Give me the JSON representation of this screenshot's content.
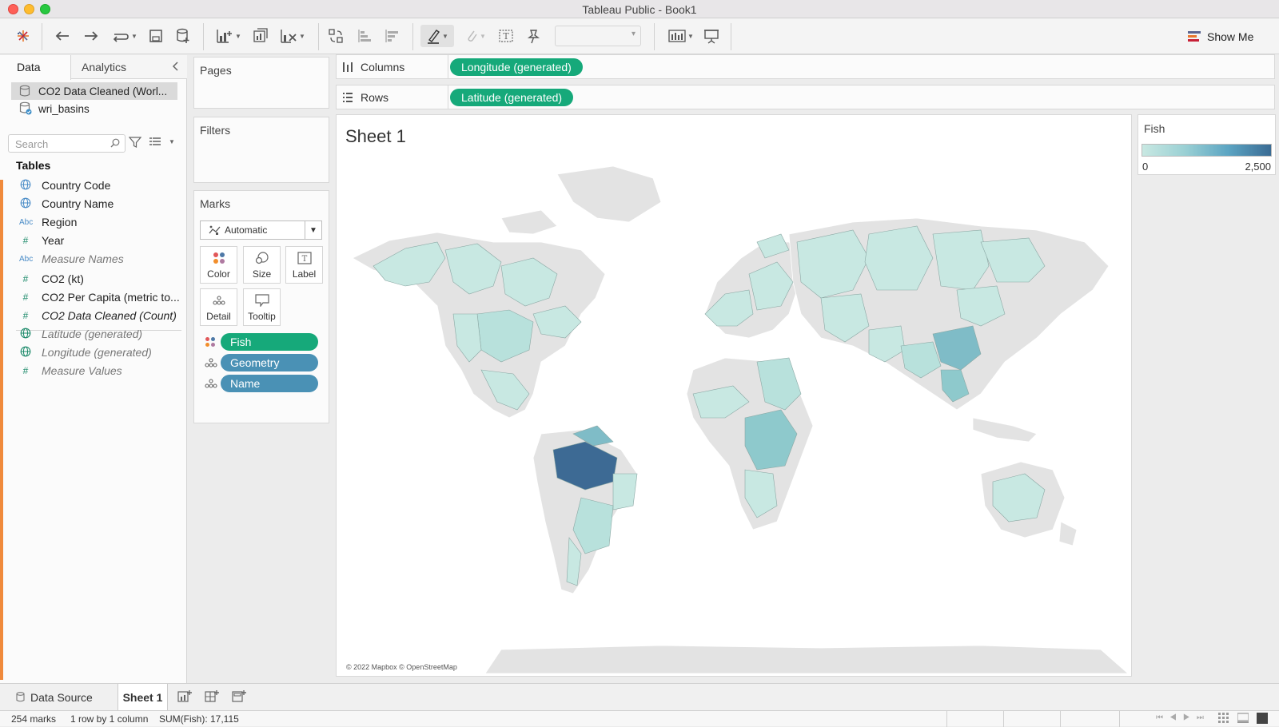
{
  "window": {
    "title": "Tableau Public - Book1"
  },
  "toolbar": {
    "show_me_label": "Show Me"
  },
  "data_pane": {
    "tab_data": "Data",
    "tab_analytics": "Analytics",
    "datasources": [
      {
        "label": "CO2 Data Cleaned (Worl..."
      },
      {
        "label": "wri_basins"
      }
    ],
    "search_placeholder": "Search",
    "tables_heading": "Tables",
    "fields": [
      {
        "icon": "globe",
        "label": "Country Code"
      },
      {
        "icon": "globe",
        "label": "Country Name"
      },
      {
        "icon": "Abc",
        "label": "Region"
      },
      {
        "icon": "#",
        "label": "Year"
      },
      {
        "icon": "Abc",
        "label": "Measure Names"
      },
      {
        "icon": "#",
        "label": "CO2 (kt)"
      },
      {
        "icon": "#",
        "label": "CO2 Per Capita (metric to..."
      },
      {
        "icon": "#",
        "label": "CO2 Data Cleaned (Count)"
      },
      {
        "icon": "globe",
        "label": "Latitude (generated)"
      },
      {
        "icon": "globe",
        "label": "Longitude (generated)"
      },
      {
        "icon": "#",
        "label": "Measure Values"
      }
    ]
  },
  "cards": {
    "pages": "Pages",
    "filters": "Filters",
    "marks": "Marks",
    "mark_type": "Automatic",
    "buttons": {
      "color": "Color",
      "size": "Size",
      "label": "Label",
      "detail": "Detail",
      "tooltip": "Tooltip"
    },
    "pills": [
      {
        "label": "Fish",
        "kind": "color",
        "color": "#16a97a"
      },
      {
        "label": "Geometry",
        "kind": "detail",
        "color": "#4a91b5"
      },
      {
        "label": "Name",
        "kind": "detail",
        "color": "#4a91b5"
      }
    ]
  },
  "shelves": {
    "columns_label": "Columns",
    "columns_pill": "Longitude (generated)",
    "rows_label": "Rows",
    "rows_pill": "Latitude (generated)"
  },
  "view": {
    "sheet_title": "Sheet 1",
    "attribution": "© 2022 Mapbox © OpenStreetMap",
    "map_colors": {
      "low": "#c8e8e2",
      "mid": "#8ec9cc",
      "high": "#3d6a94",
      "nodata": "#e3e3e3"
    }
  },
  "legend": {
    "title": "Fish",
    "min": "0",
    "max": "2,500"
  },
  "bottom": {
    "data_source_tab": "Data Source",
    "sheet_tab": "Sheet 1"
  },
  "status": {
    "marks": "254 marks",
    "rows_cols": "1 row by 1 column",
    "sum": "SUM(Fish): 17,115"
  }
}
